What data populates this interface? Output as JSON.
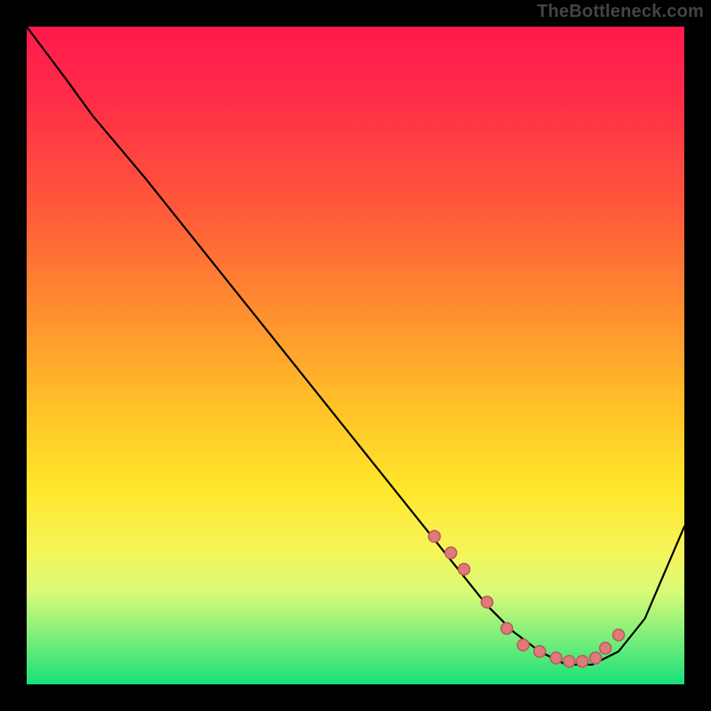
{
  "watermark": "TheBottleneck.com",
  "colors": {
    "frame_bg": "#000000",
    "curve_stroke": "#000000",
    "dot_fill": "#e07a7a",
    "dot_stroke": "#b85a5a",
    "gradient_top": "#ff1a4d",
    "gradient_bottom": "#17e07a"
  },
  "chart_data": {
    "type": "line",
    "title": "",
    "xlabel": "",
    "ylabel": "",
    "xlim": [
      0,
      100
    ],
    "ylim": [
      0,
      100
    ],
    "grid": false,
    "legend": false,
    "series": [
      {
        "name": "curve",
        "x": [
          0,
          6,
          10,
          18,
          26,
          34,
          42,
          50,
          58,
          62,
          66,
          70,
          74,
          78,
          82,
          86,
          90,
          94,
          100
        ],
        "values": [
          100,
          92,
          86.5,
          77,
          67,
          57,
          47,
          37,
          27,
          22,
          17,
          12,
          8,
          5,
          3,
          3,
          5,
          10,
          24
        ]
      }
    ],
    "markers": {
      "x": [
        62,
        64.5,
        66.5,
        70,
        73,
        75.5,
        78,
        80.5,
        82.5,
        84.5,
        86.5,
        88,
        90
      ],
      "values": [
        22.5,
        20,
        17.5,
        12.5,
        8.5,
        6,
        5,
        4,
        3.5,
        3.5,
        4,
        5.5,
        7.5
      ]
    }
  }
}
